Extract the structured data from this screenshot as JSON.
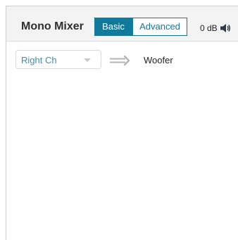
{
  "header": {
    "title": "Mono Mixer",
    "mode_tabs": [
      {
        "label": "Basic",
        "active": true
      },
      {
        "label": "Advanced",
        "active": false
      }
    ],
    "volume": "0 dB",
    "volume_icon": "speaker-volume-icon"
  },
  "routing": {
    "input_channel": "Right Ch",
    "arrow_icon": "double-arrow-right-icon",
    "output": "Woofer"
  },
  "colors": {
    "accent": "#117a9c",
    "select_text": "#3c8db2",
    "header_bg": "#f3f3f3"
  }
}
